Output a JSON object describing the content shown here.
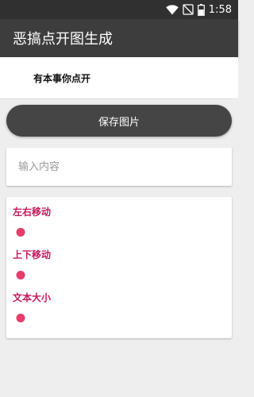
{
  "status_bar": {
    "time": "1:58",
    "icons": [
      "wifi-icon",
      "no-signal-icon",
      "battery-icon"
    ],
    "battery_level": 0.6
  },
  "app_bar": {
    "title": "恶搞点开图生成"
  },
  "preview": {
    "text": "有本事你点开"
  },
  "save_button": {
    "label": "保存图片"
  },
  "text_input": {
    "placeholder": "输入内容",
    "value": ""
  },
  "controls": [
    {
      "label": "左右移动",
      "value": 0.0
    },
    {
      "label": "上下移动",
      "value": 0.0
    },
    {
      "label": "文本大小",
      "value": 0.0
    }
  ],
  "colors": {
    "app_bar": "#3d3d3d",
    "button": "#454545",
    "label_accent": "#c2185b",
    "slider_thumb": "#e63d6c"
  }
}
